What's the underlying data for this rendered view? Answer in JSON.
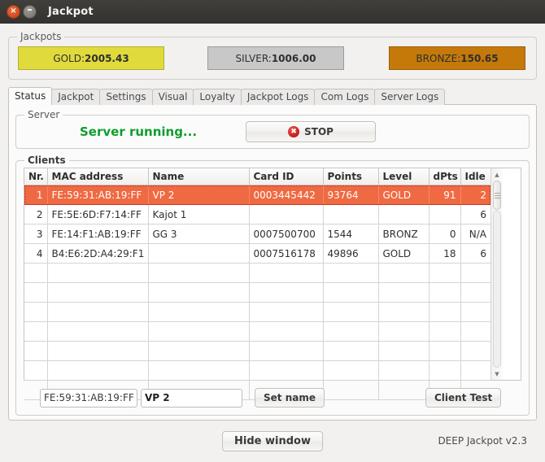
{
  "window": {
    "title": "Jackpot",
    "close_glyph": "×",
    "minimize_glyph": "–"
  },
  "jackpots": {
    "group_title": "Jackpots",
    "items": [
      {
        "label": "GOLD:",
        "value": "2005.43",
        "color": "#e0da3c",
        "name": "gold"
      },
      {
        "label": "SILVER: ",
        "value": "1006.00",
        "color": "#c8c8c8",
        "name": "silver"
      },
      {
        "label": "BRONZE: ",
        "value": "150.65",
        "color": "#c4790a",
        "name": "bronze"
      }
    ]
  },
  "tabs": [
    {
      "label": "Status",
      "active": true
    },
    {
      "label": "Jackpot",
      "active": false
    },
    {
      "label": "Settings",
      "active": false
    },
    {
      "label": "Visual",
      "active": false
    },
    {
      "label": "Loyalty",
      "active": false
    },
    {
      "label": "Jackpot Logs",
      "active": false
    },
    {
      "label": "Com Logs",
      "active": false
    },
    {
      "label": "Server Logs",
      "active": false
    }
  ],
  "server": {
    "group_title": "Server",
    "status_text": "Server running...",
    "status_color": "#0f9d2e",
    "stop_button_label": "STOP",
    "stop_icon": "stop-error-icon",
    "stop_icon_glyph": "✖"
  },
  "clients": {
    "group_title": "Clients",
    "columns": [
      "Nr.",
      "MAC address",
      "Name",
      "Card ID",
      "Points",
      "Level",
      "dPts",
      "Idle"
    ],
    "rows": [
      {
        "nr": "1",
        "mac": "FE:59:31:AB:19:FF",
        "name": "VP 2",
        "card_id": "0003445442",
        "points": "93764",
        "level": "GOLD",
        "dpts": "91",
        "idle": "2",
        "selected": true
      },
      {
        "nr": "2",
        "mac": "FE:5E:6D:F7:14:FF",
        "name": "Kajot 1",
        "card_id": "",
        "points": "",
        "level": "",
        "dpts": "",
        "idle": "6",
        "selected": false
      },
      {
        "nr": "3",
        "mac": "FE:14:F1:AB:19:FF",
        "name": "GG 3",
        "card_id": "0007500700",
        "points": "1544",
        "level": "BRONZ",
        "dpts": "0",
        "idle": "N/A",
        "selected": false
      },
      {
        "nr": "4",
        "mac": "B4:E6:2D:A4:29:F1",
        "name": "",
        "card_id": "0007516178",
        "points": "49896",
        "level": "GOLD",
        "dpts": "18",
        "idle": "6",
        "selected": false
      }
    ],
    "empty_row_count": 7,
    "selection_color": "#ef6a42",
    "controls": {
      "mac_value": "FE:59:31:AB:19:FF",
      "mac_placeholder": "",
      "name_value": "VP 2",
      "name_placeholder": "",
      "set_name_label": "Set name",
      "client_test_label": "Client Test"
    },
    "scrollbar": {
      "up_glyph": "▲",
      "down_glyph": "▼"
    }
  },
  "footer": {
    "hide_window_label": "Hide window",
    "version": "DEEP Jackpot v2.3"
  }
}
